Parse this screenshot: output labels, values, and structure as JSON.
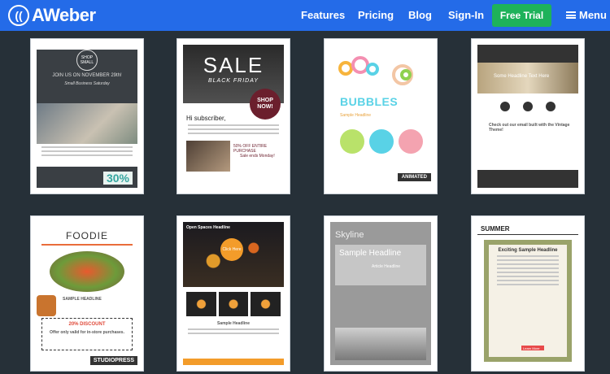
{
  "nav": {
    "logo": "AWeber",
    "links": [
      "Features",
      "Pricing",
      "Blog",
      "Sign-In"
    ],
    "cta": "Free Trial",
    "menu": "Menu"
  },
  "templates": [
    {
      "t1": "SHOP SMALL",
      "t2": "JOIN US ON NOVEMBER 29th!",
      "t3": "Small Business Saturday",
      "t4": "30%"
    },
    {
      "t1": "SALE",
      "t2": "BLACK FRIDAY",
      "t3": "SHOP NOW!",
      "t4": "Hi subscriber,",
      "t5": "50% OFF ENTIRE PURCHASE",
      "t6": "Sale ends Monday!"
    },
    {
      "t1": "BUBBLES",
      "t2": "Sample Headline",
      "t3": "ANIMATED"
    },
    {
      "t1": "Some Headline Text Here",
      "t2": "Check out our email built with the Vintage Theme!"
    },
    {
      "t1": "FOODIE",
      "t2": "SAMPLE HEADLINE",
      "t3": "20% DISCOUNT",
      "t4": "Offer only valid for in-store purchases.",
      "t5": "STUDIOPRESS"
    },
    {
      "t1": "Open Spaces Headline",
      "t2": "Click Here",
      "t3": "Sample Headline"
    },
    {
      "t1": "Skyline",
      "t2": "Sample Headline",
      "t3": "Article Headline"
    },
    {
      "t1": "SUMMER",
      "t2": "Exciting Sample Headline",
      "t3": "Learn More"
    }
  ],
  "colors": {
    "nav": "#246be8",
    "cta": "#1eb25a",
    "bg": "#263038"
  }
}
